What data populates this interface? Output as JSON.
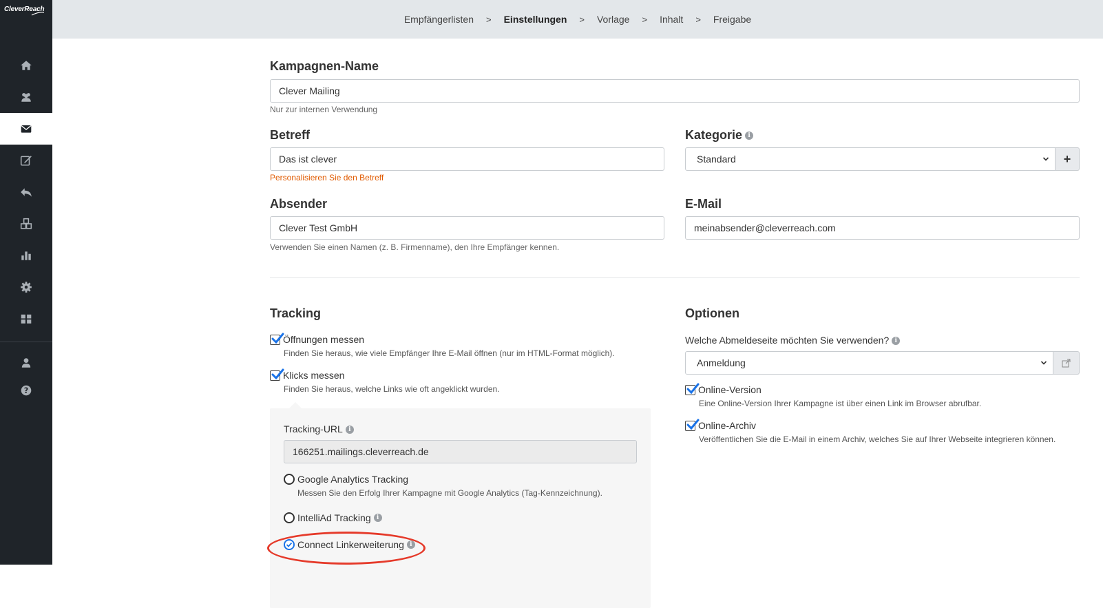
{
  "app": {
    "logo": "CleverReach"
  },
  "sidebar": {
    "items": [
      {
        "icon": "home-icon"
      },
      {
        "icon": "users-icon"
      },
      {
        "icon": "envelope-icon",
        "active": true
      },
      {
        "icon": "edit-icon"
      },
      {
        "icon": "reply-icon"
      },
      {
        "icon": "cubes-icon"
      },
      {
        "icon": "bar-chart-icon"
      },
      {
        "icon": "gear-icon"
      },
      {
        "icon": "grid-icon"
      },
      {
        "icon": "user-icon"
      },
      {
        "icon": "help-icon"
      }
    ]
  },
  "breadcrumb": {
    "steps": [
      "Empfängerlisten",
      "Einstellungen",
      "Vorlage",
      "Inhalt",
      "Freigabe"
    ],
    "active": "Einstellungen",
    "separator": ">"
  },
  "form": {
    "campaign_name": {
      "label": "Kampagnen-Name",
      "value": "Clever Mailing",
      "help": "Nur zur internen Verwendung"
    },
    "subject": {
      "label": "Betreff",
      "value": "Das ist clever",
      "help": "Personalisieren Sie den Betreff"
    },
    "category": {
      "label": "Kategorie",
      "value": "Standard",
      "add_label": "+"
    },
    "sender": {
      "label": "Absender",
      "value": "Clever Test GmbH",
      "help": "Verwenden Sie einen Namen (z. B. Firmenname), den Ihre Empfänger kennen."
    },
    "email": {
      "label": "E-Mail",
      "value": "meinabsender@cleverreach.com"
    }
  },
  "tracking": {
    "title": "Tracking",
    "opens": {
      "label": "Öffnungen messen",
      "desc": "Finden Sie heraus, wie viele Empfänger Ihre E-Mail öffnen (nur im HTML-Format möglich).",
      "checked": true
    },
    "clicks": {
      "label": "Klicks messen",
      "desc": "Finden Sie heraus, welche Links wie oft angeklickt wurden.",
      "checked": true
    },
    "url": {
      "label": "Tracking-URL",
      "value": "166251.mailings.cleverreach.de"
    },
    "google": {
      "label": "Google Analytics Tracking",
      "desc": "Messen Sie den Erfolg Ihrer Kampagne mit Google Analytics (Tag-Kennzeichnung).",
      "checked": false
    },
    "intelliad": {
      "label": "IntelliAd Tracking",
      "checked": false
    },
    "connect": {
      "label": "Connect Linkerweiterung",
      "checked": true
    }
  },
  "options": {
    "title": "Optionen",
    "unsubscribe": {
      "label": "Welche Abmeldeseite möchten Sie verwenden?",
      "value": "Anmeldung"
    },
    "online_version": {
      "label": "Online-Version",
      "desc": "Eine Online-Version Ihrer Kampagne ist über einen Link im Browser abrufbar.",
      "checked": true
    },
    "online_archive": {
      "label": "Online-Archiv",
      "desc": "Veröffentlichen Sie die E-Mail in einem Archiv, welches Sie auf Ihrer Webseite integrieren können.",
      "checked": true
    }
  },
  "colors": {
    "sidebar": "#1f2429",
    "topbar": "#e3e7ea",
    "accent": "#1a73e8",
    "warn": "#e05a00",
    "highlight": "#e53a2a"
  }
}
